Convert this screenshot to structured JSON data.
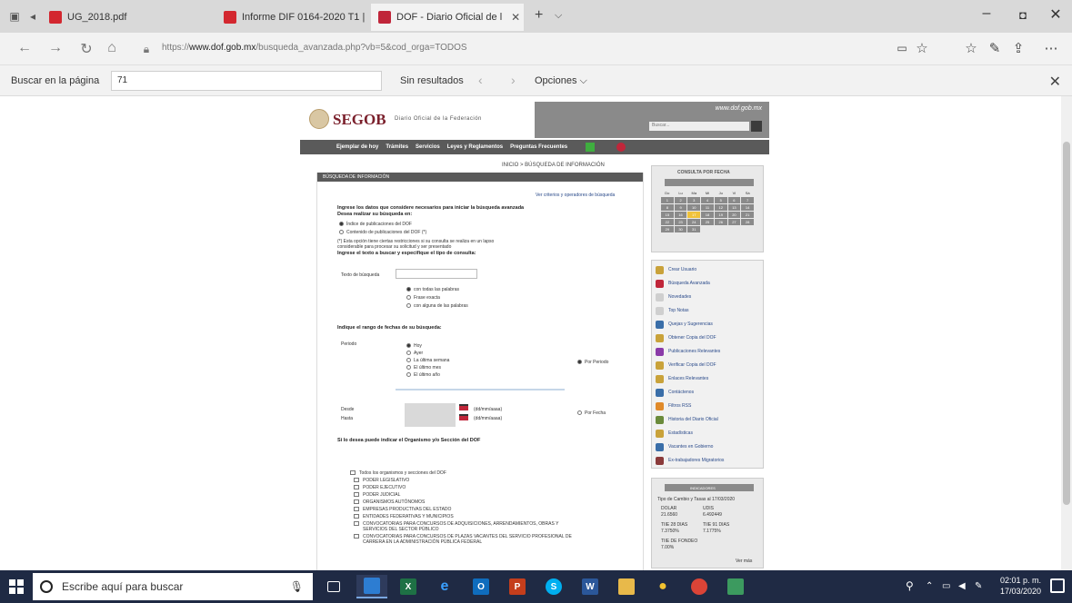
{
  "browser": {
    "tabs": [
      {
        "label": "UG_2018.pdf",
        "active": false
      },
      {
        "label": "Informe DIF 0164-2020 T1 |",
        "active": false
      },
      {
        "label": "DOF - Diario Oficial de l",
        "active": true
      }
    ],
    "url_prefix": "https://",
    "url_domain": "www.dof.gob.mx",
    "url_path": "/busqueda_avanzada.php?vb=5&cod_orga=TODOS"
  },
  "findbar": {
    "label": "Buscar en la página",
    "value": "71",
    "status": "Sin resultados",
    "options": "Opciones"
  },
  "site": {
    "logo": "SEGOB",
    "logo_sub": "Diario Oficial de la Federación",
    "domain": "www.dof.gob.mx",
    "search_placeholder": "Buscar...",
    "nav": [
      "Ejemplar de hoy",
      "Trámites",
      "Servicios",
      "Leyes y Reglamentos",
      "Preguntas Frecuentes"
    ],
    "breadcrumb": "INICIO > BÚSQUEDA DE INFORMACIÓN",
    "section_title": "BÚSQUEDA DE INFORMACIÓN",
    "criteria_link": "Ver criterios y operadores de búsqueda",
    "intro": "Ingrese los datos que considere necesarios para iniciar la búsqueda avanzada",
    "where": "Desea realizar su búsqueda en:",
    "where_opts": [
      "Índice de publicaciones del DOF",
      "Contenido de publicaciones del DOF (*)"
    ],
    "note": "(*) Esta opción tiene ciertas restricciones si su consulta se realiza en un lapso",
    "note2": "considerable para procesar su solicitud y ser presentado",
    "text_label": "Ingrese el texto a buscar y especifique el tipo de consulta:",
    "term_label": "Texto de búsqueda",
    "term_opts": [
      "con todas las palabras",
      "Frase exacta",
      "con alguna de las palabras"
    ],
    "date_label": "Indique el rango de fechas de su búsqueda:",
    "period_label": "Periodo",
    "period_opts": [
      "Hoy",
      "Ayer",
      "La última semana",
      "El último mes",
      "El último año"
    ],
    "by_period": "Por Periodo",
    "from_label": "Desde",
    "to_label": "Hasta",
    "date_fmt": "(dd/mm/aaaa)",
    "by_date": "Por Fecha",
    "org_label": "Si lo desea puede indicar el Organismo y/o Sección del DOF",
    "org_items": [
      "Todos los organismos y secciones del DOF",
      "PODER LEGISLATIVO",
      "PODER EJECUTIVO",
      "PODER JUDICIAL",
      "ORGANISMOS AUTÓNOMOS",
      "EMPRESAS PRODUCTIVAS DEL ESTADO",
      "ENTIDADES FEDERATIVAS Y MUNICIPIOS",
      "CONVOCATORIAS PARA CONCURSOS DE ADQUISICIONES, ARRENDAMIENTOS, OBRAS Y SERVICIOS DEL SECTOR PÚBLICO",
      "CONVOCATORIAS PARA CONCURSOS DE PLAZAS VACANTES DEL SERVICIO PROFESIONAL DE CARRERA EN LA ADMINISTRACIÓN PÚBLICA FEDERAL"
    ],
    "calendar_title": "CONSULTA POR FECHA",
    "calendar_head": [
      "Do",
      "Lu",
      "Ma",
      "Mi",
      "Ju",
      "Vi",
      "Sá"
    ],
    "calendar_days": [
      "1",
      "2",
      "3",
      "4",
      "5",
      "6",
      "7",
      "8",
      "9",
      "10",
      "11",
      "12",
      "13",
      "14",
      "15",
      "16",
      "17",
      "18",
      "19",
      "20",
      "21",
      "22",
      "23",
      "24",
      "25",
      "26",
      "27",
      "28",
      "29",
      "30",
      "31"
    ],
    "calendar_today": "17",
    "side_links": [
      {
        "label": "Crear Usuario",
        "color": "#c9a23a"
      },
      {
        "label": "Búsqueda Avanzada",
        "color": "#c0263a"
      },
      {
        "label": "Novedades",
        "color": "#cfcfcf"
      },
      {
        "label": "Top Notas",
        "color": "#cfcfcf"
      },
      {
        "label": "Quejas y Sugerencias",
        "color": "#3a6ea8"
      },
      {
        "label": "Obtener Copia del DOF",
        "color": "#c9a23a"
      },
      {
        "label": "Publicaciones Relevantes",
        "color": "#8a3aa8"
      },
      {
        "label": "Verificar Copia del DOF",
        "color": "#c9a23a"
      },
      {
        "label": "Enlaces Relevantes",
        "color": "#c9a23a"
      },
      {
        "label": "Contáctenos",
        "color": "#3a6ea8"
      },
      {
        "label": "Filtros RSS",
        "color": "#e08a2a"
      },
      {
        "label": "Historia del Diario Oficial",
        "color": "#6a8a3a"
      },
      {
        "label": "Estadísticas",
        "color": "#c9a23a"
      },
      {
        "label": "Vacantes en Gobierno",
        "color": "#3a6ea8"
      },
      {
        "label": "Ex-trabajadores Migratorios",
        "color": "#8a3a3a"
      }
    ],
    "indicators_title": "INDICADORES",
    "indicators_date": "Tipo de Cambio y Tasas al 17/03/2020",
    "indicators": [
      {
        "label": "DOLAR",
        "value": "21.6560"
      },
      {
        "label": "UDIS",
        "value": "6.492449"
      },
      {
        "label": "TIIE 28 DIAS",
        "value": "7.3750%"
      },
      {
        "label": "TIIE 91 DIAS",
        "value": "7.1775%"
      },
      {
        "label": "TIIE DE FONDEO",
        "value": "7.00%"
      }
    ],
    "more": "Ver más"
  },
  "taskbar": {
    "search_placeholder": "Escribe aquí para buscar",
    "time": "02:01 p. m.",
    "date": "17/03/2020"
  }
}
